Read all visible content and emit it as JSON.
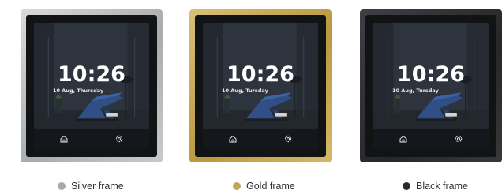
{
  "panels": [
    {
      "frame_color": "#b7babd",
      "time": "10:26",
      "date": "10 Aug, Thursday",
      "caption": "Silver frame",
      "dot_color": "#a7aaab",
      "icons": [
        "home-icon",
        "gear-icon"
      ]
    },
    {
      "frame_color": "#c4a656",
      "time": "10:26",
      "date": "10 Aug, Tursday",
      "caption": "Gold frame",
      "dot_color": "#c4a656",
      "icons": [
        "home-icon",
        "gear-icon"
      ]
    },
    {
      "frame_color": "#2c2e31",
      "time": "10:26",
      "date": "10 Aug, Tursday",
      "caption": "Black frame",
      "dot_color": "#2a2a2a",
      "icons": [
        "home-icon",
        "gear-icon"
      ]
    }
  ]
}
